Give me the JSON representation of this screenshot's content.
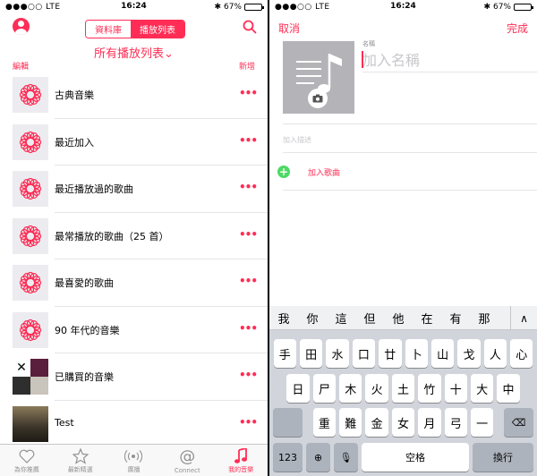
{
  "status_bar": {
    "carrier": "●●●○○ LTE",
    "time": "16:24",
    "battery": "67%",
    "battery_level": 0.67
  },
  "library": {
    "tabs": [
      "資料庫",
      "播放列表"
    ],
    "active_tab": "播放列表",
    "subtitle": "所有播放列表⌄",
    "edit_label": "編輯",
    "new_label": "新增",
    "playlists": [
      {
        "title": "古典音樂",
        "thumb": "flower-icon"
      },
      {
        "title": "最近加入",
        "thumb": "flower-icon"
      },
      {
        "title": "最近播放過的歌曲",
        "thumb": "flower-icon"
      },
      {
        "title": "最常播放的歌曲（25 首）",
        "thumb": "flower-icon"
      },
      {
        "title": "最喜愛的歌曲",
        "thumb": "flower-icon"
      },
      {
        "title": "90 年代的音樂",
        "thumb": "flower-icon"
      },
      {
        "title": "已購買的音樂",
        "thumb": "album-collage"
      },
      {
        "title": "Test",
        "thumb": "album-art"
      }
    ],
    "more_label": "•••",
    "tab_bar": [
      {
        "label": "為你推薦",
        "icon": "heart-icon"
      },
      {
        "label": "最新精選",
        "icon": "star-icon"
      },
      {
        "label": "廣播",
        "icon": "radio-icon"
      },
      {
        "label": "Connect",
        "icon": "at-icon"
      },
      {
        "label": "我的音樂",
        "icon": "music-note-icon",
        "active": true
      }
    ]
  },
  "new_playlist": {
    "cancel_label": "取消",
    "done_label": "完成",
    "name_label": "名稱",
    "name_placeholder": "加入名稱",
    "description_placeholder": "加入描述",
    "add_songs_label": "加入歌曲"
  },
  "keyboard": {
    "candidates": [
      "我",
      "你",
      "這",
      "但",
      "他",
      "在",
      "有",
      "那"
    ],
    "row1": [
      "手",
      "田",
      "水",
      "口",
      "廿",
      "卜",
      "山",
      "戈",
      "人",
      "心"
    ],
    "row2": [
      "日",
      "尸",
      "木",
      "火",
      "土",
      "竹",
      "十",
      "大",
      "中"
    ],
    "row3": [
      "重",
      "難",
      "金",
      "女",
      "月",
      "弓",
      "一"
    ],
    "numbers_key": "123",
    "space_key": "空格",
    "return_key": "換行"
  },
  "colors": {
    "accent": "#ff2d55",
    "add_green": "#4cd964"
  }
}
